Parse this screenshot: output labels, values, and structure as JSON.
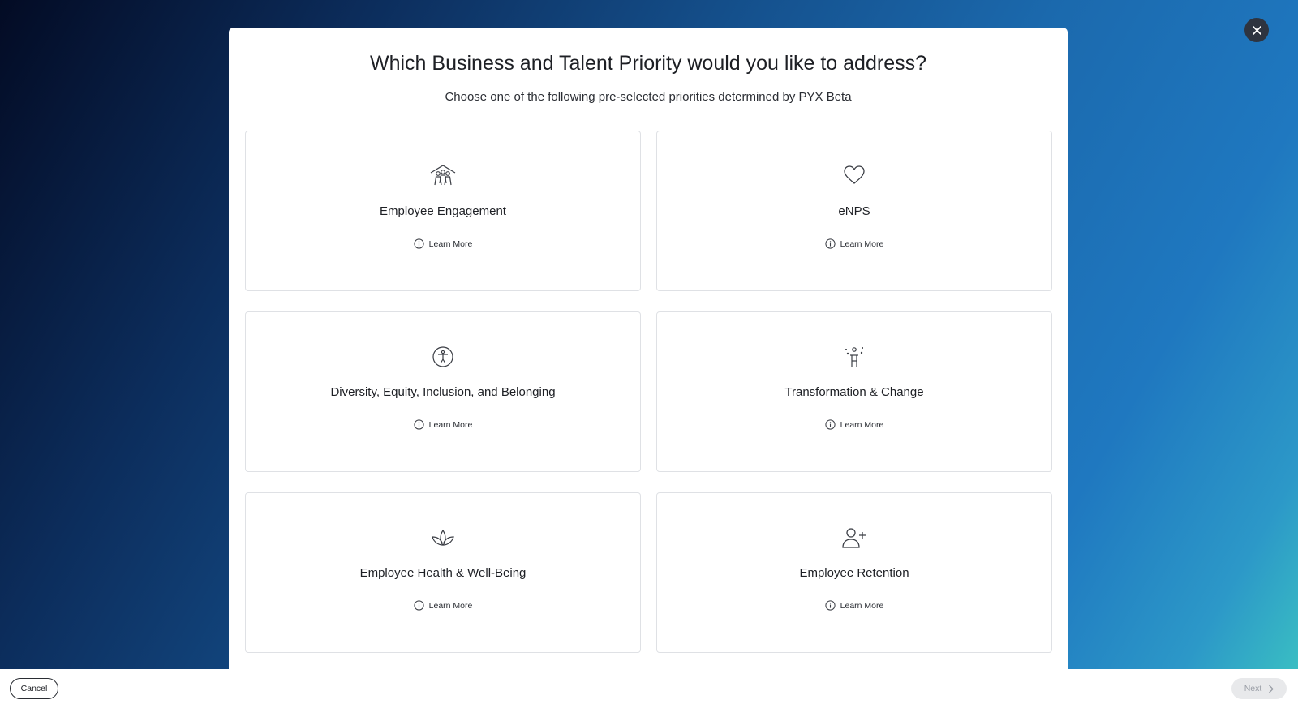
{
  "modal": {
    "title": "Which Business and Talent Priority would you like to address?",
    "subtitle": "Choose one of the following pre-selected priorities determined by PYX Beta"
  },
  "cards": [
    {
      "title": "Employee Engagement",
      "icon": "people-house-icon",
      "learn_more": "Learn More"
    },
    {
      "title": "eNPS",
      "icon": "heart-icon",
      "learn_more": "Learn More"
    },
    {
      "title": "Diversity, Equity, Inclusion, and Belonging",
      "icon": "accessibility-icon",
      "learn_more": "Learn More"
    },
    {
      "title": "Transformation & Change",
      "icon": "person-sparkle-icon",
      "learn_more": "Learn More"
    },
    {
      "title": "Employee Health & Well-Being",
      "icon": "lotus-icon",
      "learn_more": "Learn More"
    },
    {
      "title": "Employee Retention",
      "icon": "add-user-icon",
      "learn_more": "Learn More"
    }
  ],
  "footer": {
    "cancel_label": "Cancel",
    "next_label": "Next"
  },
  "colors": {
    "close_button_bg": "#2e3440",
    "next_disabled_bg": "#e8e9eb"
  }
}
